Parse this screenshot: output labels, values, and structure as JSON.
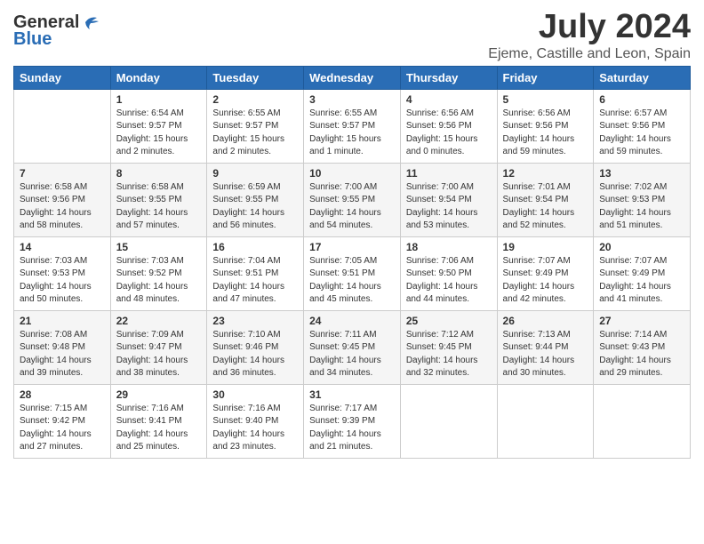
{
  "header": {
    "logo_general": "General",
    "logo_blue": "Blue",
    "month": "July 2024",
    "location": "Ejeme, Castille and Leon, Spain"
  },
  "weekdays": [
    "Sunday",
    "Monday",
    "Tuesday",
    "Wednesday",
    "Thursday",
    "Friday",
    "Saturday"
  ],
  "weeks": [
    [
      {
        "day": "",
        "info": ""
      },
      {
        "day": "1",
        "info": "Sunrise: 6:54 AM\nSunset: 9:57 PM\nDaylight: 15 hours\nand 2 minutes."
      },
      {
        "day": "2",
        "info": "Sunrise: 6:55 AM\nSunset: 9:57 PM\nDaylight: 15 hours\nand 2 minutes."
      },
      {
        "day": "3",
        "info": "Sunrise: 6:55 AM\nSunset: 9:57 PM\nDaylight: 15 hours\nand 1 minute."
      },
      {
        "day": "4",
        "info": "Sunrise: 6:56 AM\nSunset: 9:56 PM\nDaylight: 15 hours\nand 0 minutes."
      },
      {
        "day": "5",
        "info": "Sunrise: 6:56 AM\nSunset: 9:56 PM\nDaylight: 14 hours\nand 59 minutes."
      },
      {
        "day": "6",
        "info": "Sunrise: 6:57 AM\nSunset: 9:56 PM\nDaylight: 14 hours\nand 59 minutes."
      }
    ],
    [
      {
        "day": "7",
        "info": "Sunrise: 6:58 AM\nSunset: 9:56 PM\nDaylight: 14 hours\nand 58 minutes."
      },
      {
        "day": "8",
        "info": "Sunrise: 6:58 AM\nSunset: 9:55 PM\nDaylight: 14 hours\nand 57 minutes."
      },
      {
        "day": "9",
        "info": "Sunrise: 6:59 AM\nSunset: 9:55 PM\nDaylight: 14 hours\nand 56 minutes."
      },
      {
        "day": "10",
        "info": "Sunrise: 7:00 AM\nSunset: 9:55 PM\nDaylight: 14 hours\nand 54 minutes."
      },
      {
        "day": "11",
        "info": "Sunrise: 7:00 AM\nSunset: 9:54 PM\nDaylight: 14 hours\nand 53 minutes."
      },
      {
        "day": "12",
        "info": "Sunrise: 7:01 AM\nSunset: 9:54 PM\nDaylight: 14 hours\nand 52 minutes."
      },
      {
        "day": "13",
        "info": "Sunrise: 7:02 AM\nSunset: 9:53 PM\nDaylight: 14 hours\nand 51 minutes."
      }
    ],
    [
      {
        "day": "14",
        "info": "Sunrise: 7:03 AM\nSunset: 9:53 PM\nDaylight: 14 hours\nand 50 minutes."
      },
      {
        "day": "15",
        "info": "Sunrise: 7:03 AM\nSunset: 9:52 PM\nDaylight: 14 hours\nand 48 minutes."
      },
      {
        "day": "16",
        "info": "Sunrise: 7:04 AM\nSunset: 9:51 PM\nDaylight: 14 hours\nand 47 minutes."
      },
      {
        "day": "17",
        "info": "Sunrise: 7:05 AM\nSunset: 9:51 PM\nDaylight: 14 hours\nand 45 minutes."
      },
      {
        "day": "18",
        "info": "Sunrise: 7:06 AM\nSunset: 9:50 PM\nDaylight: 14 hours\nand 44 minutes."
      },
      {
        "day": "19",
        "info": "Sunrise: 7:07 AM\nSunset: 9:49 PM\nDaylight: 14 hours\nand 42 minutes."
      },
      {
        "day": "20",
        "info": "Sunrise: 7:07 AM\nSunset: 9:49 PM\nDaylight: 14 hours\nand 41 minutes."
      }
    ],
    [
      {
        "day": "21",
        "info": "Sunrise: 7:08 AM\nSunset: 9:48 PM\nDaylight: 14 hours\nand 39 minutes."
      },
      {
        "day": "22",
        "info": "Sunrise: 7:09 AM\nSunset: 9:47 PM\nDaylight: 14 hours\nand 38 minutes."
      },
      {
        "day": "23",
        "info": "Sunrise: 7:10 AM\nSunset: 9:46 PM\nDaylight: 14 hours\nand 36 minutes."
      },
      {
        "day": "24",
        "info": "Sunrise: 7:11 AM\nSunset: 9:45 PM\nDaylight: 14 hours\nand 34 minutes."
      },
      {
        "day": "25",
        "info": "Sunrise: 7:12 AM\nSunset: 9:45 PM\nDaylight: 14 hours\nand 32 minutes."
      },
      {
        "day": "26",
        "info": "Sunrise: 7:13 AM\nSunset: 9:44 PM\nDaylight: 14 hours\nand 30 minutes."
      },
      {
        "day": "27",
        "info": "Sunrise: 7:14 AM\nSunset: 9:43 PM\nDaylight: 14 hours\nand 29 minutes."
      }
    ],
    [
      {
        "day": "28",
        "info": "Sunrise: 7:15 AM\nSunset: 9:42 PM\nDaylight: 14 hours\nand 27 minutes."
      },
      {
        "day": "29",
        "info": "Sunrise: 7:16 AM\nSunset: 9:41 PM\nDaylight: 14 hours\nand 25 minutes."
      },
      {
        "day": "30",
        "info": "Sunrise: 7:16 AM\nSunset: 9:40 PM\nDaylight: 14 hours\nand 23 minutes."
      },
      {
        "day": "31",
        "info": "Sunrise: 7:17 AM\nSunset: 9:39 PM\nDaylight: 14 hours\nand 21 minutes."
      },
      {
        "day": "",
        "info": ""
      },
      {
        "day": "",
        "info": ""
      },
      {
        "day": "",
        "info": ""
      }
    ]
  ]
}
